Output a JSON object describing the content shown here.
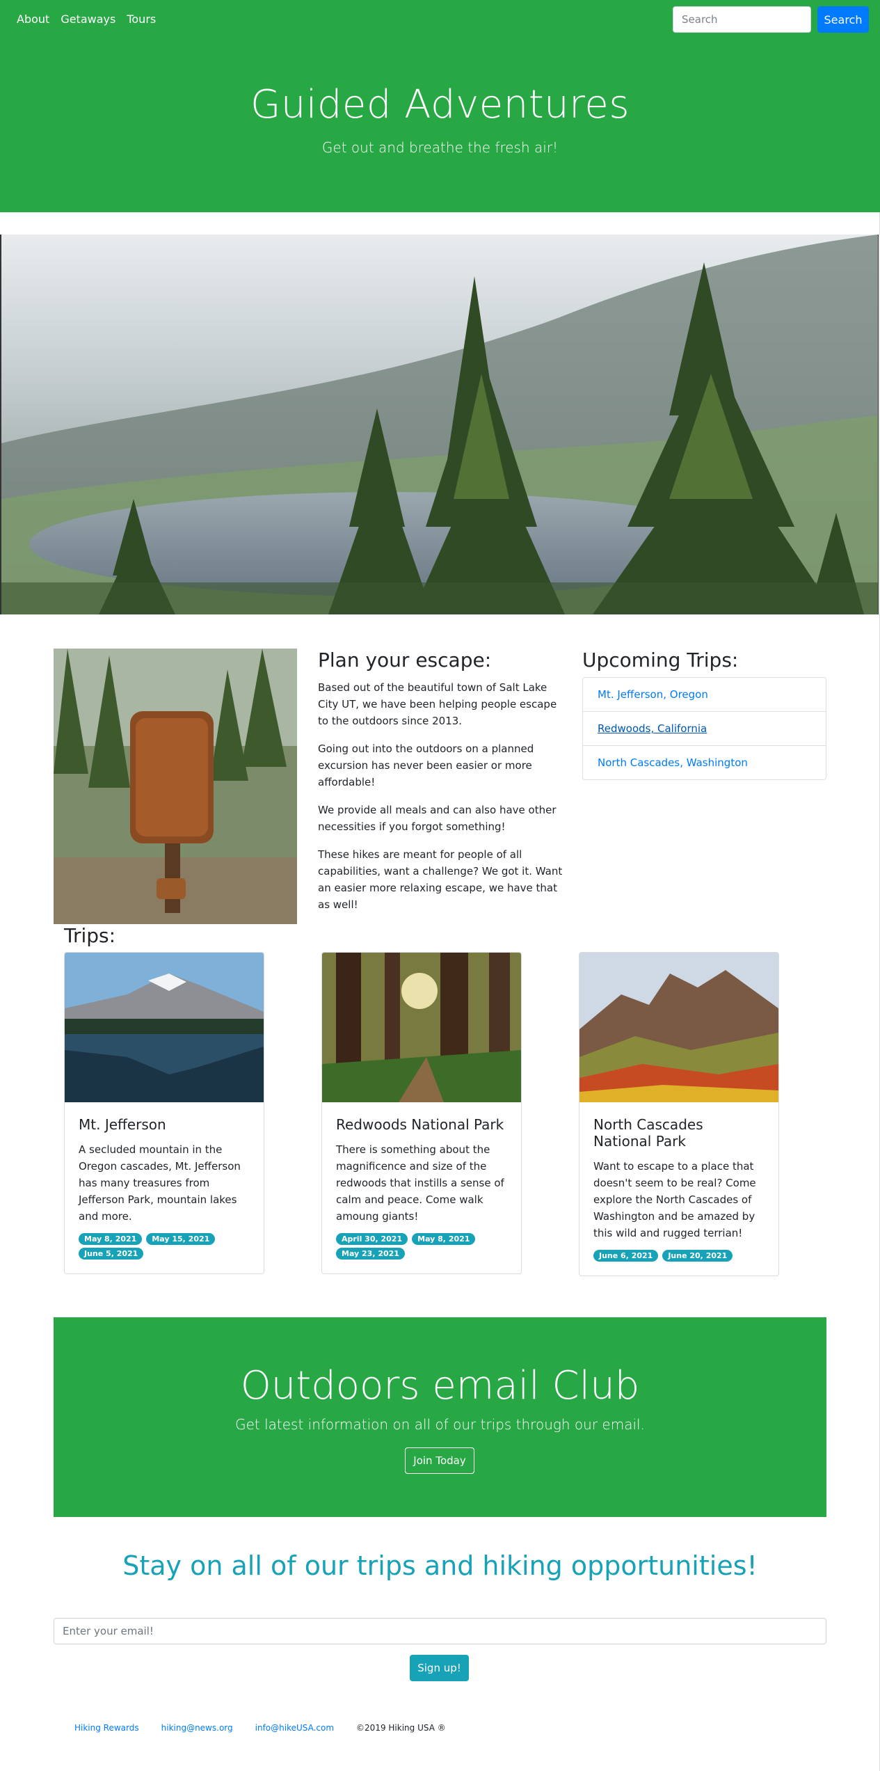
{
  "colors": {
    "brand_green": "#28a745",
    "primary_blue": "#007bff",
    "info_teal": "#17a2b8"
  },
  "nav": {
    "links": [
      "About",
      "Getaways",
      "Tours"
    ],
    "search_placeholder": "Search",
    "search_button": "Search"
  },
  "hero": {
    "title": "Guided Adventures",
    "subtitle": "Get out and breathe the fresh air!"
  },
  "about": {
    "title": "Plan your escape:",
    "paragraphs": [
      "Based out of the beautiful town of Salt Lake City UT, we have been helping people escape to the outdoors since 2013.",
      "Going out into the outdoors on a planned excursion has never been easier or more affordable!",
      "We provide all meals and can also have other necessities if you forgot something!",
      "These hikes are meant for people of all capabilities, want a challenge? We got it. Want an easier more relaxing escape, we have that as well!"
    ]
  },
  "upcoming": {
    "title": "Upcoming Trips:",
    "items": [
      "Mt. Jefferson, Oregon",
      "Redwoods, California",
      "North Cascades, Washington"
    ]
  },
  "trips": {
    "title": "Trips:",
    "cards": [
      {
        "title": "Mt. Jefferson",
        "text": "A secluded mountain in the Oregon cascades, Mt. Jefferson has many treasures from Jefferson Park, mountain lakes and more.",
        "dates": [
          "May 8, 2021",
          "May 15, 2021",
          "June 5, 2021"
        ]
      },
      {
        "title": "Redwoods National Park",
        "text": "There is something about the magnificence and size of the redwoods that instills a sense of calm and peace. Come walk amoung giants!",
        "dates": [
          "April 30, 2021",
          "May 8, 2021",
          "May 23, 2021"
        ]
      },
      {
        "title": "North Cascades National Park",
        "text": "Want to escape to a place that doesn't seem to be real? Come explore the North Cascades of Washington and be amazed by this wild and rugged terrian!",
        "dates": [
          "June 6, 2021",
          "June 20, 2021"
        ]
      }
    ]
  },
  "club": {
    "title": "Outdoors email Club",
    "subtitle": "Get latest information on all of our trips through our email.",
    "button": "Join Today"
  },
  "signup": {
    "title": "Stay on all of our trips and hiking opportunities!",
    "email_placeholder": "Enter your email!",
    "button": "Sign up!"
  },
  "footer": {
    "links": [
      "Hiking Rewards",
      "hiking@news.org",
      "info@hikeUSA.com"
    ],
    "copyright": "©2019 Hiking USA ®"
  }
}
